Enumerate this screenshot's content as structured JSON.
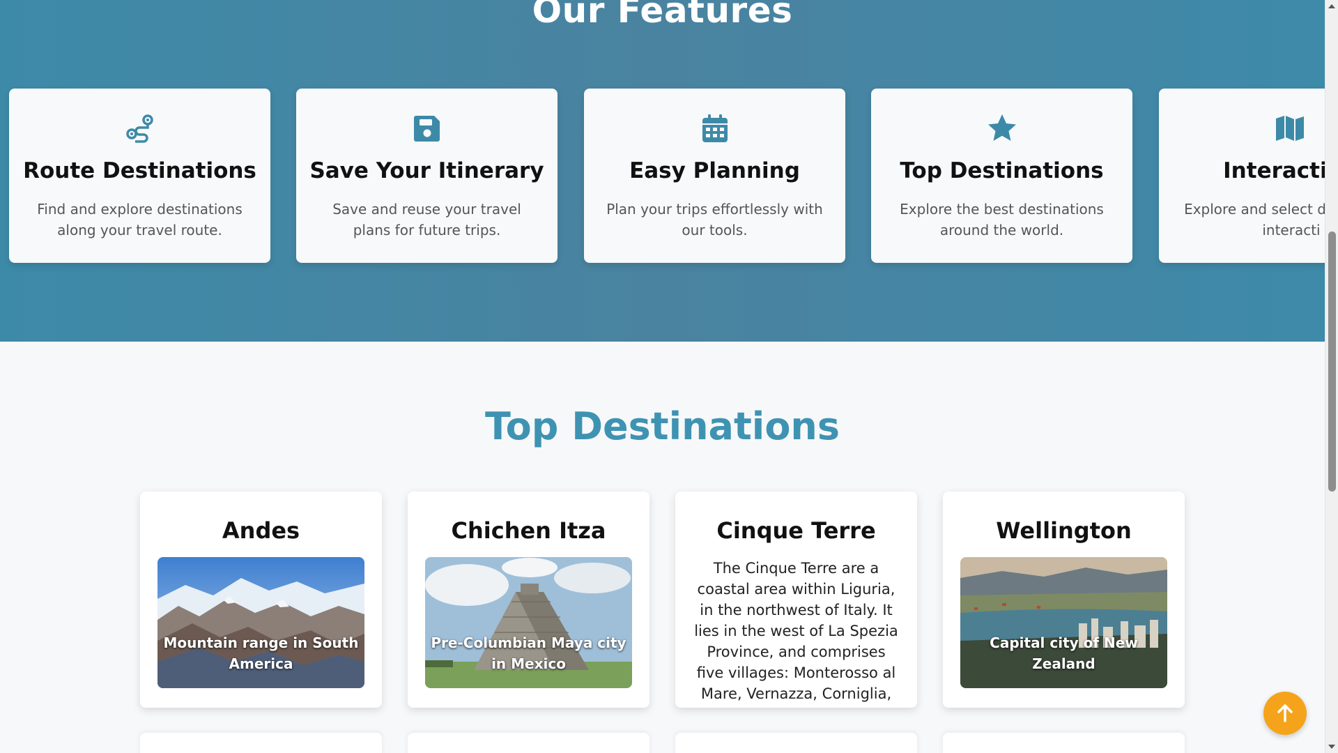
{
  "features": {
    "title": "Our Features",
    "cards": [
      {
        "icon": "route-icon",
        "title": "Route Destinations",
        "desc": "Find and explore destinations along your travel route."
      },
      {
        "icon": "save-icon",
        "title": "Save Your Itinerary",
        "desc": "Save and reuse your travel plans for future trips."
      },
      {
        "icon": "calendar-icon",
        "title": "Easy Planning",
        "desc": "Plan your trips effortlessly with our tools."
      },
      {
        "icon": "star-icon",
        "title": "Top Destinations",
        "desc": "Explore the best destinations around the world."
      },
      {
        "icon": "map-icon",
        "title": "Interactive",
        "desc": "Explore and select de using an interacti"
      }
    ]
  },
  "destinations": {
    "title": "Top Destinations",
    "cards": [
      {
        "name": "Andes",
        "caption": "Mountain range in South America"
      },
      {
        "name": "Chichen Itza",
        "caption": "Pre-Columbian Maya city in Mexico"
      },
      {
        "name": "Cinque Terre",
        "description": "The Cinque Terre are a coastal area within Liguria, in the northwest of Italy. It lies in the west of La Spezia Province, and comprises five villages: Monterosso al Mare, Vernazza, Corniglia,"
      },
      {
        "name": "Wellington",
        "caption": "Capital city of New Zealand"
      }
    ]
  },
  "colors": {
    "band": "#3d8aa8",
    "accent": "#3f93b2",
    "scroll_button": "#f5a31a"
  },
  "scroll_top": {
    "icon": "arrow-up-icon"
  }
}
